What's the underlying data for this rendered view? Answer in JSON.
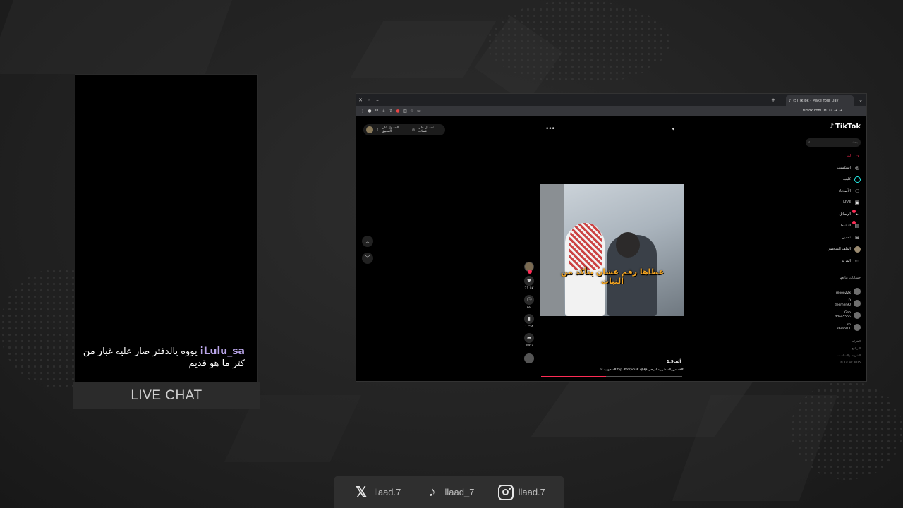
{
  "chat": {
    "username": "iLulu_sa",
    "message": "يووه يالدفتر صار عليه غبار من كثر ما هو قديم",
    "footer_label": "LIVE CHAT"
  },
  "browser": {
    "tab_title": "(5)TikTok - Make Your Day",
    "url": "tiktok.com",
    "page": {
      "get_app_label": "الحصول على التطبيق",
      "get_coins_label": "تحصيل على عملات",
      "video_overlay_text": "عطاها رقم عشان يتأكد من الثبات",
      "views": "1.9ألف",
      "caption": "#قصص_الصمتي_ماله_حل 😂😂 #fyp #foryou #سعوديه",
      "caption_suffix": "ss",
      "likes": "21.9K",
      "comments": "69",
      "saves": "1754",
      "shares": "3862",
      "progress_pct": 46
    },
    "sidebar": {
      "logo": "TikTok",
      "search_placeholder": "بحث",
      "nav": [
        {
          "label": "لك",
          "icon": "home-icon",
          "active": true
        },
        {
          "label": "استكشف",
          "icon": "compass-icon",
          "active": false
        },
        {
          "label": "كلينبه",
          "icon": "circle-icon",
          "active": false
        },
        {
          "label": "الأصدقاء",
          "icon": "friends-icon",
          "active": false
        },
        {
          "label": "LIVE",
          "icon": "live-icon",
          "active": false
        },
        {
          "label": "الرسائل",
          "icon": "messages-icon",
          "active": false
        },
        {
          "label": "النشاط",
          "icon": "activity-icon",
          "active": false
        },
        {
          "label": "تحميل",
          "icon": "upload-icon",
          "active": false
        },
        {
          "label": "الملف الشخصي",
          "icon": "profile-icon",
          "active": false
        },
        {
          "label": "المزيد",
          "icon": "more-icon",
          "active": false
        }
      ],
      "following_title": "حسابات تتابعها",
      "following": [
        {
          "name": "mooo22x",
          "sub": "..."
        },
        {
          "name": "deemer90",
          "sub": "D"
        },
        {
          "name": "ddoo5555",
          "sub": "Goo"
        },
        {
          "name": "shrool11",
          "sub": "sh"
        }
      ],
      "footer": [
        "الشركة",
        "البرنامج",
        "الشروط والسياسات",
        "TikTok 2025 ©"
      ]
    }
  },
  "socials": [
    {
      "icon": "x-logo-icon",
      "handle": "llaad.7"
    },
    {
      "icon": "tiktok-logo-icon",
      "handle": "llaad_7"
    },
    {
      "icon": "instagram-logo-icon",
      "handle": "llaad.7"
    }
  ],
  "colors": {
    "accent": "#fe2c55",
    "username": "#b9a5e8",
    "overlay_text": "#f5a623"
  }
}
